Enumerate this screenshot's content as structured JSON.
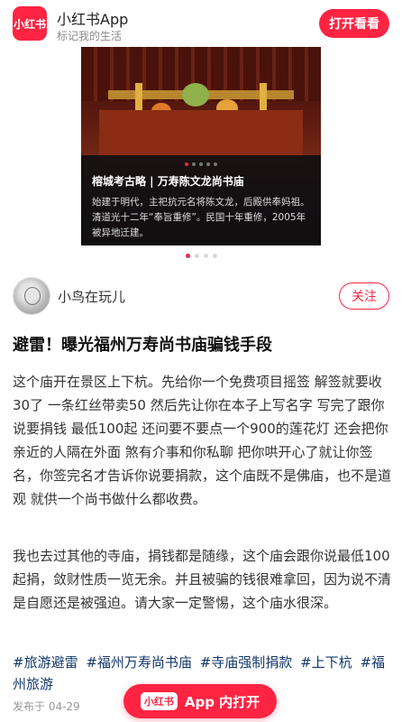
{
  "banner": {
    "logo_text": "小红书",
    "app_name": "小红书App",
    "slogan": "标记我的生活",
    "open_label": "打开看看"
  },
  "photo": {
    "caption_title": "榕城考古略 | 万寿陈文龙尚书庙",
    "caption_body": "始建于明代，主祀抗元名将陈文龙，后殿供奉妈祖。清道光十二年“奉旨重修”。民国十年重修，2005年被异地迁建。",
    "slide_count": 4,
    "active_slide": 1
  },
  "author": {
    "name": "小鸟在玩儿",
    "follow_label": "关注"
  },
  "note": {
    "title": "避雷！曝光福州万寿尚书庙骗钱手段",
    "paragraphs": [
      "这个庙开在景区上下杭。先给你一个免费项目摇签 解签就要收30了 一条红丝带卖50 然后先让你在本子上写名字 写完了跟你说要捐钱 最低100起 还问要不要点一个900的莲花灯 还会把你亲近的人隔在外面 煞有介事和你私聊 把你哄开心了就让你签名，你签完名才告诉你说要捐款，这个庙既不是佛庙，也不是道观 就供一个尚书做什么都收费。",
      "我也去过其他的寺庙，捐钱都是随缘，这个庙会跟你说最低100起捐，敛财性质一览无余。并且被骗的钱很难拿回，因为说不清是自愿还是被强迫。请大家一定警惕，这个庙水很深。"
    ],
    "tags": [
      "#旅游避雷",
      "#福州万寿尚书庙",
      "#寺庙强制捐款",
      "#上下杭",
      "#福州旅游"
    ],
    "publish_date": "发布于 04-29"
  },
  "float_button": {
    "logo_text": "小红书",
    "label": "App 内打开"
  },
  "colors": {
    "brand_red": "#ff2442",
    "tag_blue": "#13386c"
  }
}
